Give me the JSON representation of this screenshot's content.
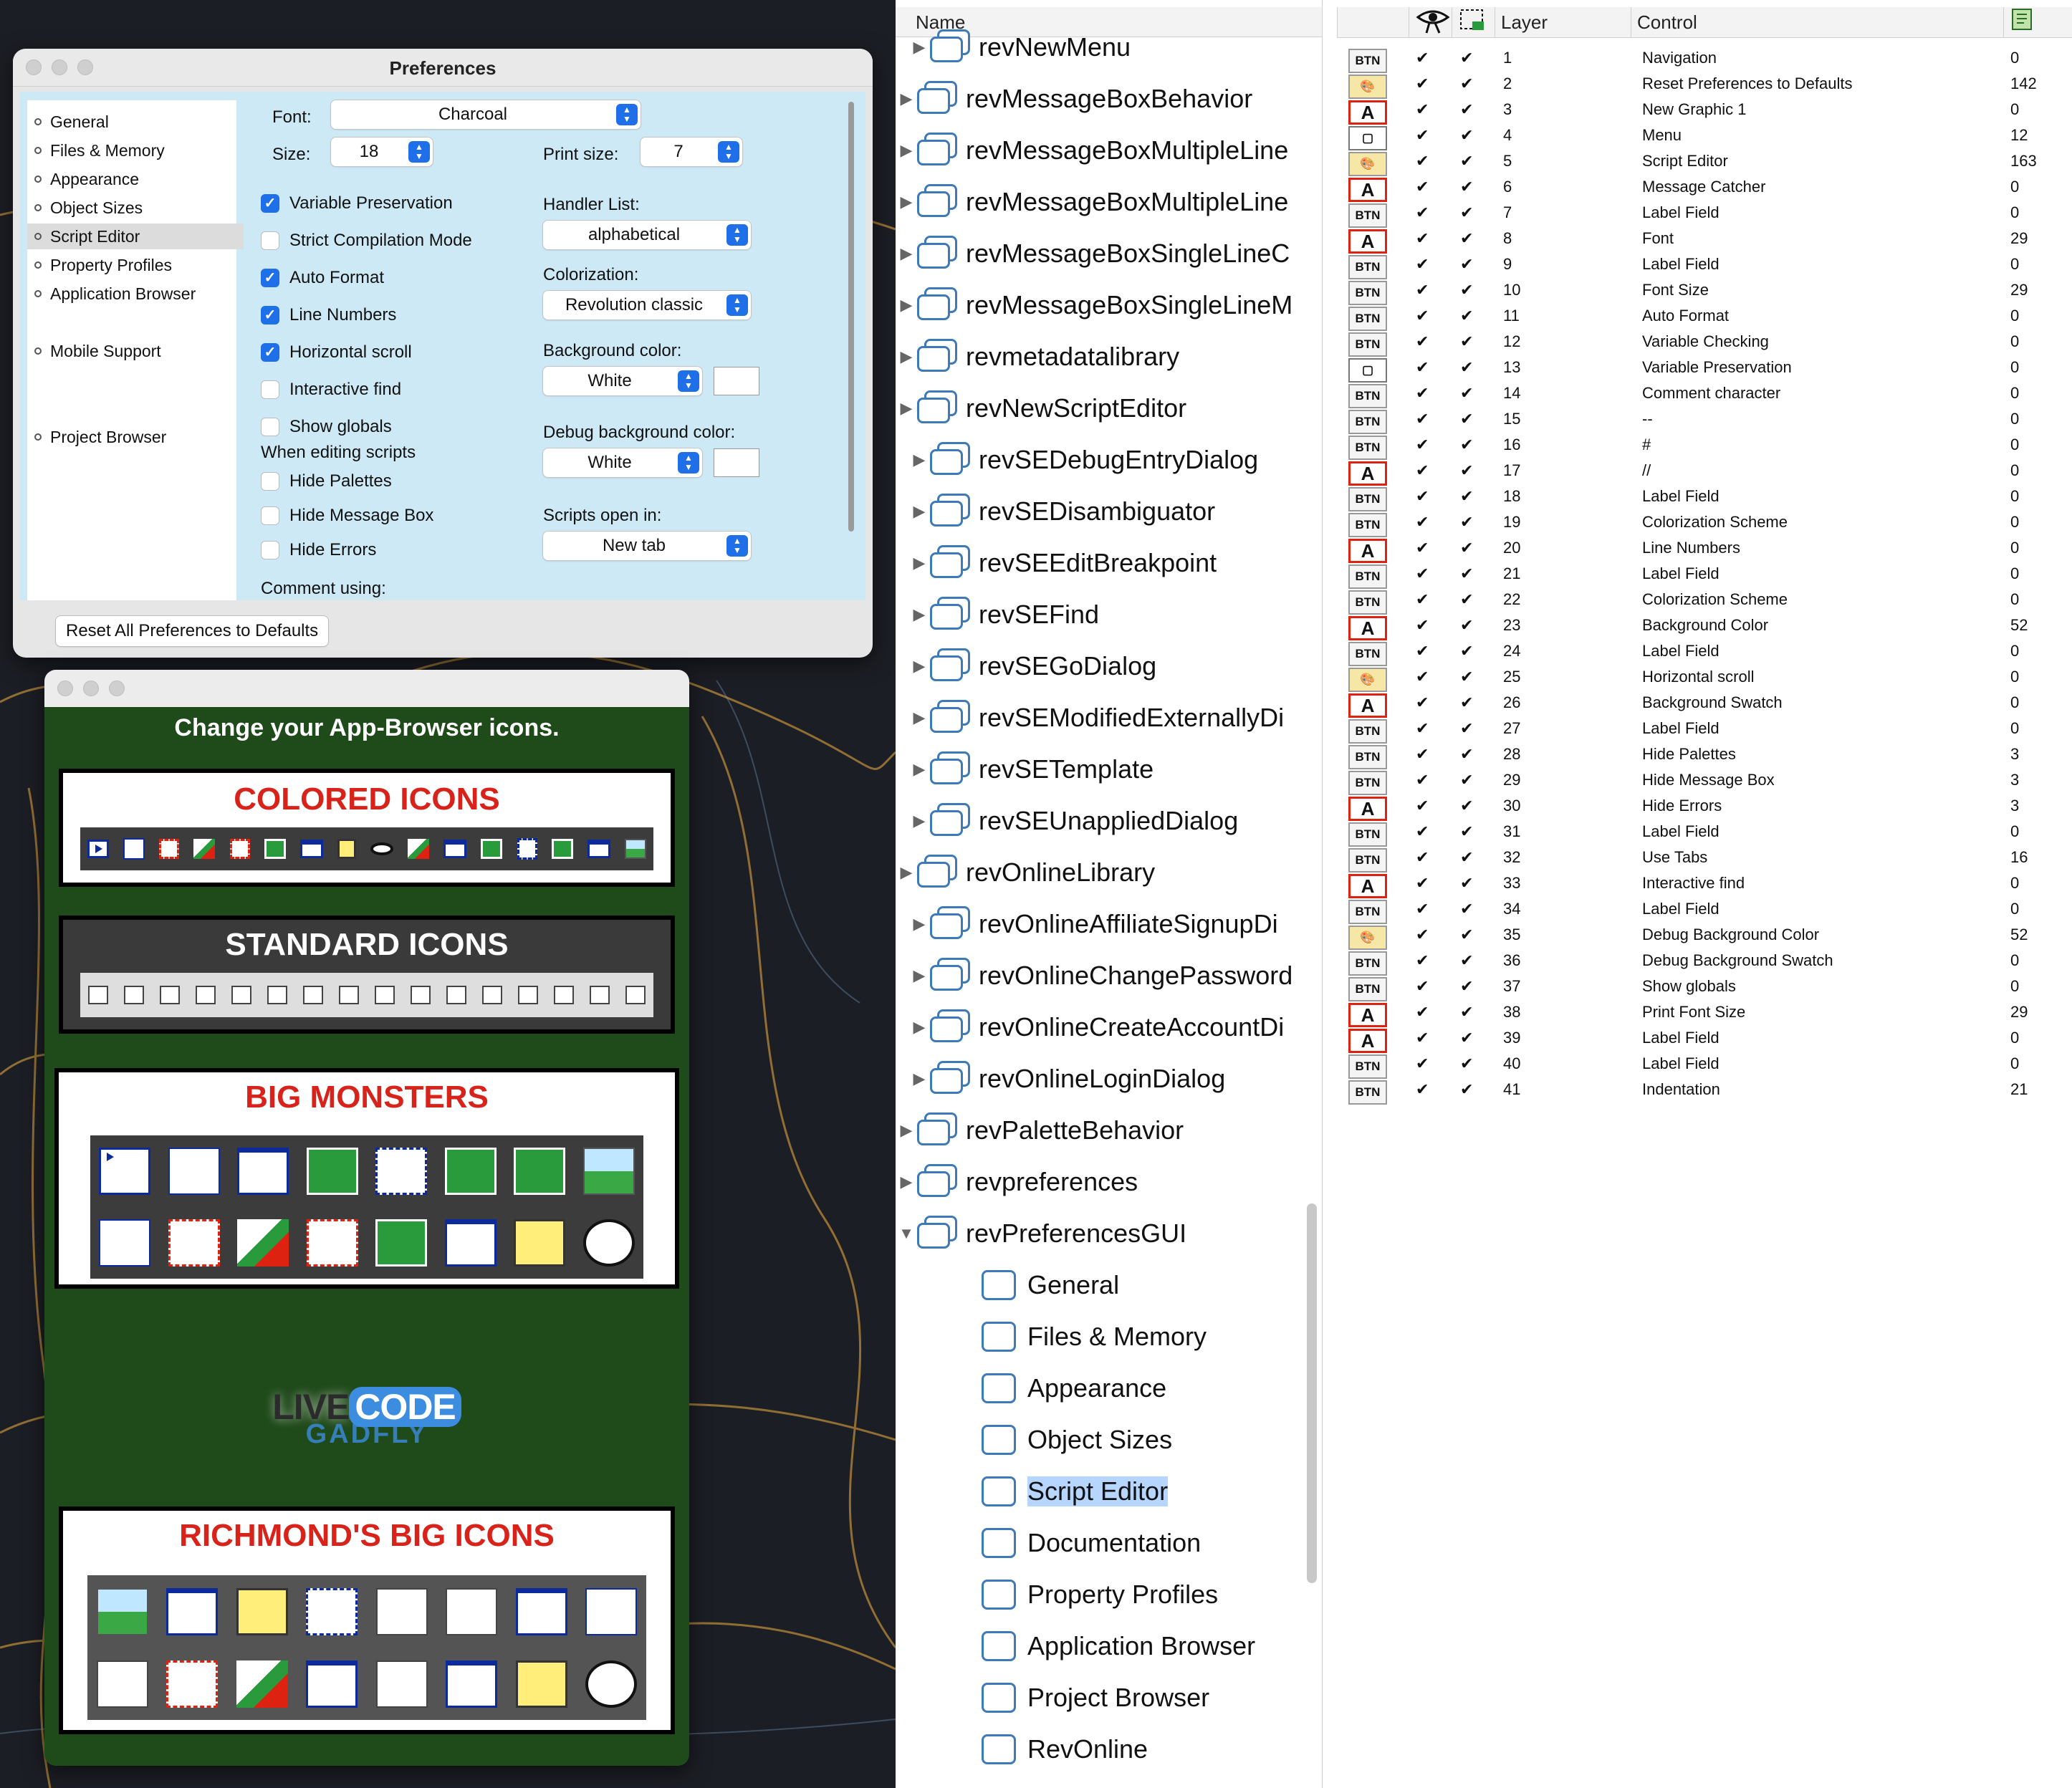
{
  "prefs": {
    "title": "Preferences",
    "nav": [
      "General",
      "Files & Memory",
      "Appearance",
      "Object Sizes",
      "Script Editor",
      "Property Profiles",
      "Application Browser",
      "Mobile Support",
      "Project Browser"
    ],
    "font_label": "Font:",
    "font_value": "Charcoal",
    "size_label": "Size:",
    "size_value": "18",
    "print_size_label": "Print size:",
    "print_size_value": "7",
    "checkboxes": [
      {
        "label": "Variable Preservation",
        "checked": true
      },
      {
        "label": "Strict Compilation Mode",
        "checked": false
      },
      {
        "label": "Auto Format",
        "checked": true
      },
      {
        "label": "Line Numbers",
        "checked": true
      },
      {
        "label": "Horizontal scroll",
        "checked": true
      },
      {
        "label": "Interactive find",
        "checked": false
      },
      {
        "label": "Show globals",
        "checked": false
      }
    ],
    "when_editing_label": "When editing scripts",
    "editing_checkboxes": [
      {
        "label": "Hide Palettes",
        "checked": false
      },
      {
        "label": "Hide Message Box",
        "checked": false
      },
      {
        "label": "Hide Errors",
        "checked": false
      }
    ],
    "comment_label": "Comment using:",
    "handler_list_label": "Handler List:",
    "handler_list_value": "alphabetical",
    "colorization_label": "Colorization:",
    "colorization_value": "Revolution classic",
    "bg_color_label": "Background color:",
    "bg_color_value": "White",
    "debug_bg_label": "Debug background color:",
    "debug_bg_value": "White",
    "scripts_open_label": "Scripts open in:",
    "scripts_open_value": "New tab",
    "reset_button": "Reset All Preferences to Defaults"
  },
  "icons_window": {
    "heading": "Change your App-Browser icons.",
    "panels": [
      "COLORED ICONS",
      "STANDARD ICONS",
      "BIG MONSTERS",
      "RICHMOND'S BIG ICONS"
    ],
    "logo": {
      "live": "LIVE",
      "code": "CODE",
      "gadfly": "GADFLY"
    }
  },
  "tree": {
    "header": "Name",
    "rows": [
      {
        "name": "revNewMenu",
        "indent": 1,
        "type": "stack",
        "open": false
      },
      {
        "name": "revMessageBoxBehavior",
        "indent": 0,
        "type": "stack",
        "open": false
      },
      {
        "name": "revMessageBoxMultipleLine",
        "indent": 0,
        "type": "stack",
        "open": false
      },
      {
        "name": "revMessageBoxMultipleLine",
        "indent": 0,
        "type": "stack",
        "open": false
      },
      {
        "name": "revMessageBoxSingleLineC",
        "indent": 0,
        "type": "stack",
        "open": false
      },
      {
        "name": "revMessageBoxSingleLineM",
        "indent": 0,
        "type": "stack",
        "open": false
      },
      {
        "name": "revmetadatalibrary",
        "indent": 0,
        "type": "stack",
        "open": false
      },
      {
        "name": "revNewScriptEditor",
        "indent": 0,
        "type": "stack",
        "open": false
      },
      {
        "name": "revSEDebugEntryDialog",
        "indent": 1,
        "type": "stack",
        "open": false
      },
      {
        "name": "revSEDisambiguator",
        "indent": 1,
        "type": "stack",
        "open": false
      },
      {
        "name": "revSEEditBreakpoint",
        "indent": 1,
        "type": "stack",
        "open": false
      },
      {
        "name": "revSEFind",
        "indent": 1,
        "type": "stack",
        "open": false
      },
      {
        "name": "revSEGoDialog",
        "indent": 1,
        "type": "stack",
        "open": false
      },
      {
        "name": "revSEModifiedExternallyDi",
        "indent": 1,
        "type": "stack",
        "open": false
      },
      {
        "name": "revSETemplate",
        "indent": 1,
        "type": "stack",
        "open": false
      },
      {
        "name": "revSEUnappliedDialog",
        "indent": 1,
        "type": "stack",
        "open": false
      },
      {
        "name": "revOnlineLibrary",
        "indent": 0,
        "type": "stack",
        "open": false
      },
      {
        "name": "revOnlineAffiliateSignupDi",
        "indent": 1,
        "type": "stack",
        "open": false
      },
      {
        "name": "revOnlineChangePassword",
        "indent": 1,
        "type": "stack",
        "open": false
      },
      {
        "name": "revOnlineCreateAccountDi",
        "indent": 1,
        "type": "stack",
        "open": false
      },
      {
        "name": "revOnlineLoginDialog",
        "indent": 1,
        "type": "stack",
        "open": false
      },
      {
        "name": "revPaletteBehavior",
        "indent": 0,
        "type": "stack",
        "open": false
      },
      {
        "name": "revpreferences",
        "indent": 0,
        "type": "stack",
        "open": false
      },
      {
        "name": "revPreferencesGUI",
        "indent": 0,
        "type": "stack",
        "open": true
      },
      {
        "name": "General",
        "indent": 2,
        "type": "card"
      },
      {
        "name": "Files & Memory",
        "indent": 2,
        "type": "card"
      },
      {
        "name": "Appearance",
        "indent": 2,
        "type": "card"
      },
      {
        "name": "Object Sizes",
        "indent": 2,
        "type": "card"
      },
      {
        "name": "Script Editor",
        "indent": 2,
        "type": "card",
        "selected": true
      },
      {
        "name": "Documentation",
        "indent": 2,
        "type": "card"
      },
      {
        "name": "Property Profiles",
        "indent": 2,
        "type": "card"
      },
      {
        "name": "Application Browser",
        "indent": 2,
        "type": "card"
      },
      {
        "name": "Project Browser",
        "indent": 2,
        "type": "card"
      },
      {
        "name": "RevOnline",
        "indent": 2,
        "type": "card"
      }
    ]
  },
  "controls": {
    "headers": {
      "layer": "Layer",
      "control": "Control"
    },
    "rows": [
      {
        "icon": "BTN",
        "layer": "1",
        "name": "Navigation",
        "lines": "0"
      },
      {
        "icon": "paint",
        "layer": "2",
        "name": "Reset Preferences to Defaults",
        "lines": "142"
      },
      {
        "icon": "A",
        "layer": "3",
        "name": "New Graphic 1",
        "lines": "0"
      },
      {
        "icon": "graphic",
        "layer": "4",
        "name": "Menu",
        "lines": "12"
      },
      {
        "icon": "paint",
        "layer": "5",
        "name": "Script Editor",
        "lines": "163"
      },
      {
        "icon": "A",
        "layer": "6",
        "name": "Message Catcher",
        "lines": "0"
      },
      {
        "icon": "BTN",
        "layer": "7",
        "name": "Label Field",
        "lines": "0"
      },
      {
        "icon": "A",
        "layer": "8",
        "name": "Font",
        "lines": "29"
      },
      {
        "icon": "BTN",
        "layer": "9",
        "name": "Label Field",
        "lines": "0"
      },
      {
        "icon": "BTN",
        "layer": "10",
        "name": "Font Size",
        "lines": "29"
      },
      {
        "icon": "BTN",
        "layer": "11",
        "name": "Auto Format",
        "lines": "0"
      },
      {
        "icon": "BTN",
        "layer": "12",
        "name": "Variable Checking",
        "lines": "0"
      },
      {
        "icon": "graphic",
        "layer": "13",
        "name": "Variable Preservation",
        "lines": "0"
      },
      {
        "icon": "BTN",
        "layer": "14",
        "name": "Comment character",
        "lines": "0"
      },
      {
        "icon": "BTN",
        "layer": "15",
        "name": "--",
        "lines": "0"
      },
      {
        "icon": "BTN",
        "layer": "16",
        "name": "#",
        "lines": "0"
      },
      {
        "icon": "A",
        "layer": "17",
        "name": "//",
        "lines": "0"
      },
      {
        "icon": "BTN",
        "layer": "18",
        "name": "Label Field",
        "lines": "0"
      },
      {
        "icon": "BTN",
        "layer": "19",
        "name": "Colorization Scheme",
        "lines": "0"
      },
      {
        "icon": "A",
        "layer": "20",
        "name": "Line Numbers",
        "lines": "0"
      },
      {
        "icon": "BTN",
        "layer": "21",
        "name": "Label Field",
        "lines": "0"
      },
      {
        "icon": "BTN",
        "layer": "22",
        "name": "Colorization Scheme",
        "lines": "0"
      },
      {
        "icon": "A",
        "layer": "23",
        "name": "Background Color",
        "lines": "52"
      },
      {
        "icon": "BTN",
        "layer": "24",
        "name": "Label Field",
        "lines": "0"
      },
      {
        "icon": "paint",
        "layer": "25",
        "name": "Horizontal scroll",
        "lines": "0"
      },
      {
        "icon": "A",
        "layer": "26",
        "name": "Background Swatch",
        "lines": "0"
      },
      {
        "icon": "BTN",
        "layer": "27",
        "name": "Label Field",
        "lines": "0"
      },
      {
        "icon": "BTN",
        "layer": "28",
        "name": "Hide Palettes",
        "lines": "3"
      },
      {
        "icon": "BTN",
        "layer": "29",
        "name": "Hide Message Box",
        "lines": "3"
      },
      {
        "icon": "A",
        "layer": "30",
        "name": "Hide Errors",
        "lines": "3"
      },
      {
        "icon": "BTN",
        "layer": "31",
        "name": "Label Field",
        "lines": "0"
      },
      {
        "icon": "BTN",
        "layer": "32",
        "name": "Use Tabs",
        "lines": "16"
      },
      {
        "icon": "A",
        "layer": "33",
        "name": "Interactive find",
        "lines": "0"
      },
      {
        "icon": "BTN",
        "layer": "34",
        "name": "Label Field",
        "lines": "0"
      },
      {
        "icon": "paint",
        "layer": "35",
        "name": "Debug Background Color",
        "lines": "52"
      },
      {
        "icon": "BTN",
        "layer": "36",
        "name": "Debug Background Swatch",
        "lines": "0"
      },
      {
        "icon": "BTN",
        "layer": "37",
        "name": "Show globals",
        "lines": "0"
      },
      {
        "icon": "A",
        "layer": "38",
        "name": "Print Font Size",
        "lines": "29"
      },
      {
        "icon": "A",
        "layer": "39",
        "name": "Label Field",
        "lines": "0"
      },
      {
        "icon": "BTN",
        "layer": "40",
        "name": "Label Field",
        "lines": "0"
      },
      {
        "icon": "BTN",
        "layer": "41",
        "name": "Indentation",
        "lines": "21"
      }
    ]
  },
  "colors": {
    "accent": "#1f6fe8",
    "prefs_bg": "#cde9f6",
    "icons_bg": "#1f4a1a",
    "panel_red": "#d8231b",
    "tree_blue": "#3e79b8"
  }
}
